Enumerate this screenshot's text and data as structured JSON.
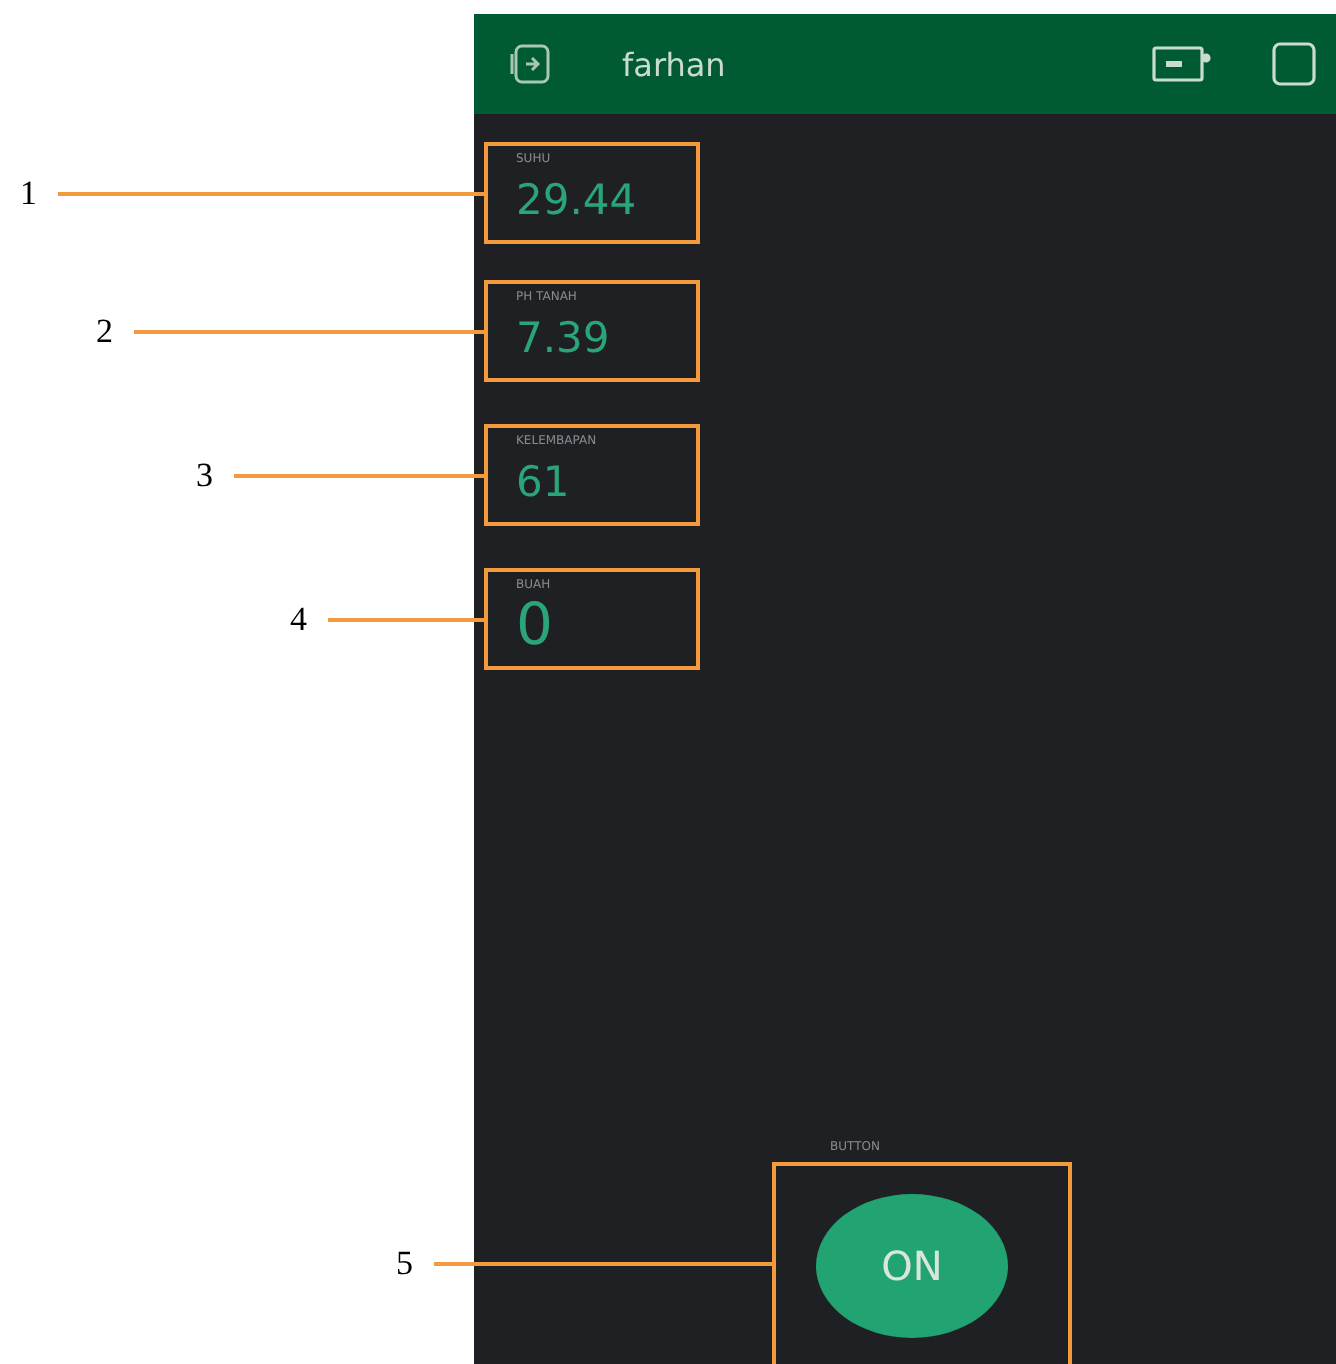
{
  "header": {
    "title": "farhan"
  },
  "widgets": [
    {
      "callout": "1",
      "label": "SUHU",
      "value": "29.44"
    },
    {
      "callout": "2",
      "label": "PH TANAH",
      "value": "7.39"
    },
    {
      "callout": "3",
      "label": "KELEMBAPAN",
      "value": "61"
    },
    {
      "callout": "4",
      "label": "BUAH",
      "value": "0"
    }
  ],
  "button": {
    "callout": "5",
    "label": "BUTTON",
    "text": "ON",
    "on": true
  }
}
